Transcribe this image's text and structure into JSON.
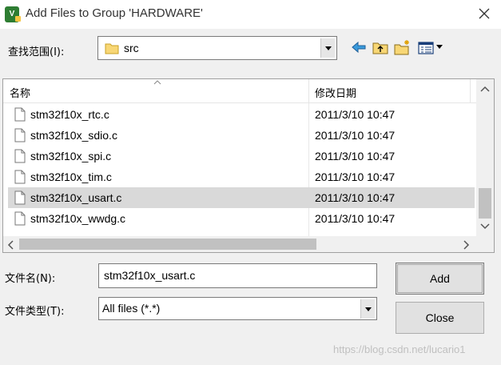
{
  "window": {
    "title": "Add Files to Group 'HARDWARE'",
    "app_icon": "uv-icon"
  },
  "look_in": {
    "label": "查找范围(I):",
    "value": "src"
  },
  "toolbar": {
    "icons": [
      "back-arrow-icon",
      "up-folder-icon",
      "new-folder-icon",
      "view-menu-icon"
    ]
  },
  "file_list": {
    "columns": [
      "名称",
      "修改日期"
    ],
    "rows": [
      {
        "name": "stm32f10x_rtc.c",
        "date": "2011/3/10 10:47"
      },
      {
        "name": "stm32f10x_sdio.c",
        "date": "2011/3/10 10:47"
      },
      {
        "name": "stm32f10x_spi.c",
        "date": "2011/3/10 10:47"
      },
      {
        "name": "stm32f10x_tim.c",
        "date": "2011/3/10 10:47"
      },
      {
        "name": "stm32f10x_usart.c",
        "date": "2011/3/10 10:47",
        "selected": true
      },
      {
        "name": "stm32f10x_wwdg.c",
        "date": "2011/3/10 10:47"
      }
    ]
  },
  "file_name": {
    "label": "文件名(N):",
    "value": "stm32f10x_usart.c"
  },
  "file_type": {
    "label": "文件类型(T):",
    "value": "All files (*.*)"
  },
  "buttons": {
    "add": "Add",
    "close": "Close"
  },
  "watermark": "https://blog.csdn.net/lucario1",
  "colors": {
    "selected_row": "#d9d9d9",
    "window_bg": "#f0f0f0",
    "app_icon": "#2e7d32"
  }
}
